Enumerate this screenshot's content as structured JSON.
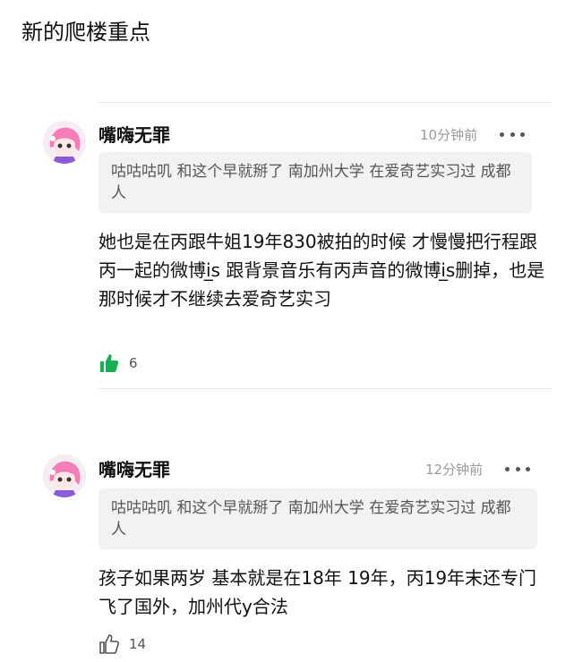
{
  "page": {
    "title": "新的爬楼重点"
  },
  "comments": [
    {
      "username": "嘴嗨无罪",
      "timestamp": "10分钟前",
      "quote": "咕咕咕叽 和这个早就掰了 南加州大学 在爱奇艺实习过 成都人",
      "body": "她也是在丙跟牛姐19年830被拍的时候 才慢慢把行程跟丙一起的微博i̲s 跟背景音乐有丙声音的微博i̲s删掉，也是那时候才不继续去爱奇艺实习",
      "likes": "6",
      "liked": true,
      "avatar_icon": "anime-pink-hair-avatar-icon",
      "like_icon": "thumbs-up-filled-icon"
    },
    {
      "username": "嘴嗨无罪",
      "timestamp": "12分钟前",
      "quote": "咕咕咕叽 和这个早就掰了 南加州大学 在爱奇艺实习过 成都人",
      "body": "孩子如果两岁 基本就是在18年 19年，丙19年末还专门飞了国外，加州代y合法",
      "likes": "14",
      "liked": false,
      "avatar_icon": "anime-pink-hair-avatar-icon",
      "like_icon": "thumbs-up-outline-icon"
    }
  ],
  "colors": {
    "like_green": "#1aad54",
    "timestamp_gray": "#9b9b9b",
    "quote_bg": "#f2f2f2"
  }
}
